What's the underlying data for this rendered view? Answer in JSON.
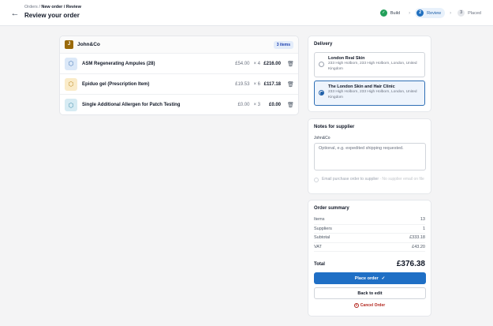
{
  "header": {
    "back_icon": "arrow-left-icon",
    "breadcrumb": {
      "parent": "Orders",
      "separator": "/",
      "current": "New order / Review"
    },
    "title": "Review your order"
  },
  "steps": [
    {
      "label": "Build",
      "state": "done",
      "marker": "✓"
    },
    {
      "label": "Review",
      "state": "active",
      "marker": "2"
    },
    {
      "label": "Placed",
      "state": "pending",
      "marker": "3"
    }
  ],
  "supplier": {
    "initial": "J",
    "name": "John&Co",
    "badge": "3 items",
    "items": [
      {
        "icon": "box-icon",
        "name": "ASM Regenerating Ampules (28)",
        "price": "£54.00",
        "qty": "× 4",
        "total": "£216.00"
      },
      {
        "icon": "box-icon",
        "name": "Epiduo gel (Prescription Item)",
        "price": "£19.53",
        "qty": "× 6",
        "total": "£117.18"
      },
      {
        "icon": "box-icon",
        "name": "Single Additional Allergen for Patch Testing",
        "price": "£0.00",
        "qty": "× 3",
        "total": "£0.00"
      }
    ]
  },
  "delivery": {
    "title": "Delivery",
    "options": [
      {
        "name": "London Real Skin",
        "address": "233 High Holborn, 233 High Holborn, London, United Kingdom",
        "selected": false
      },
      {
        "name": "The London Skin and Hair Clinic",
        "address": "233 High Holborn, 233 High Holborn, London, United Kingdom",
        "selected": true
      }
    ]
  },
  "notes": {
    "title": "Notes for supplier",
    "supplier_label": "John&Co",
    "placeholder": "Optional, e.g. expedited shipping requested.",
    "email_label": "Email purchase order to supplier",
    "email_hint": " · No supplier email on file"
  },
  "summary": {
    "title": "Order summary",
    "rows": [
      {
        "label": "Items",
        "value": "13"
      },
      {
        "label": "Suppliers",
        "value": "1"
      },
      {
        "label": "Subtotal",
        "value": "£333.18"
      },
      {
        "label": "VAT",
        "value": "£43.20"
      }
    ],
    "total_label": "Total",
    "total_value": "£376.38",
    "place_label": "Place order",
    "back_label": "Back to edit",
    "cancel_label": "Cancel Order"
  },
  "colors": {
    "primary": "#1f6fc5",
    "success": "#22a05a",
    "danger": "#b3261e",
    "supplier_avatar": "#9a6a0a"
  }
}
